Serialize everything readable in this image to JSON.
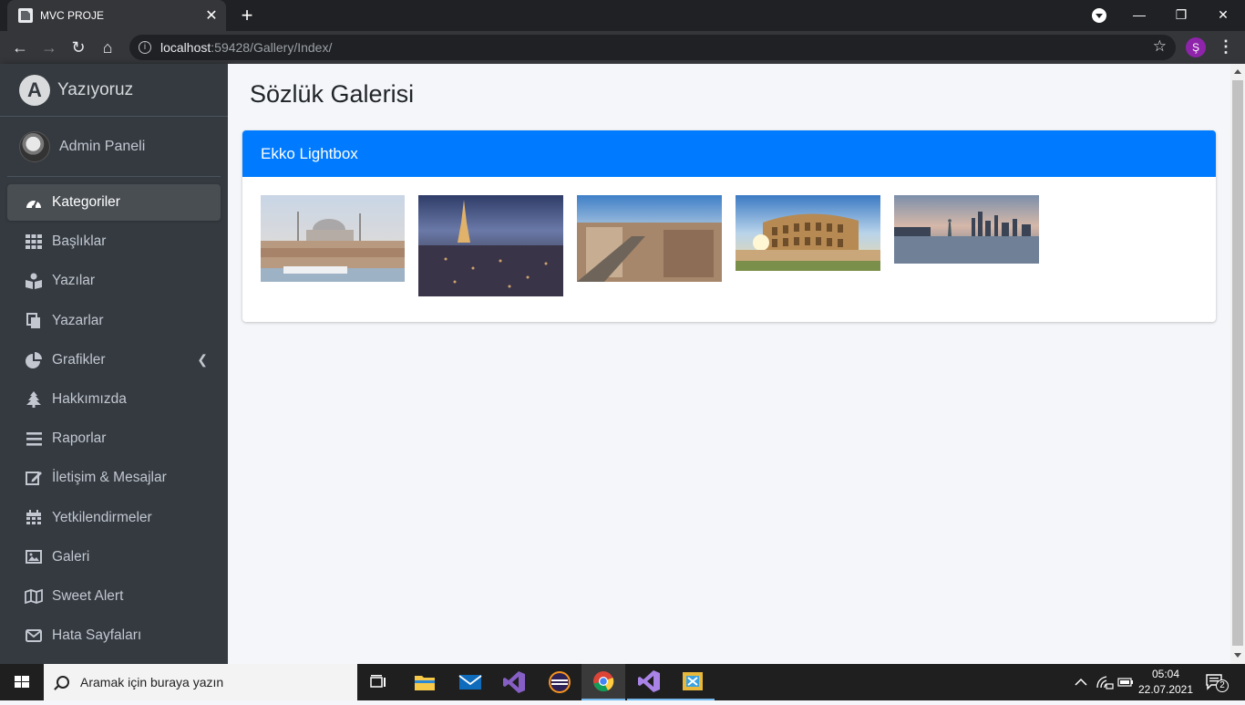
{
  "browser": {
    "tab_title": "MVC PROJE",
    "url_host": "localhost",
    "url_rest": ":59428/Gallery/Index/",
    "profile_initial": "Ş"
  },
  "sidebar": {
    "brand": "Yazıyoruz",
    "user": "Admin Paneli",
    "items": [
      {
        "label": "Kategoriler",
        "icon": "tachometer-icon",
        "active": true
      },
      {
        "label": "Başlıklar",
        "icon": "grid-icon"
      },
      {
        "label": "Yazılar",
        "icon": "book-reader-icon"
      },
      {
        "label": "Yazarlar",
        "icon": "copy-icon"
      },
      {
        "label": "Grafikler",
        "icon": "pie-chart-icon"
      },
      {
        "label": "Hakkımızda",
        "icon": "tree-icon"
      },
      {
        "label": "Raporlar",
        "icon": "bars-icon"
      },
      {
        "label": "İletişim & Mesajlar",
        "icon": "edit-icon"
      },
      {
        "label": "Yetkilendirmeler",
        "icon": "calendar-icon"
      },
      {
        "label": "Galeri",
        "icon": "image-icon"
      },
      {
        "label": "Sweet Alert",
        "icon": "map-icon"
      },
      {
        "label": "Hata Sayfaları",
        "icon": "envelope-icon"
      }
    ]
  },
  "main": {
    "title": "Sözlük Galerisi",
    "card_title": "Ekko Lightbox",
    "images": [
      {
        "name": "istanbul-thumbnail"
      },
      {
        "name": "paris-thumbnail"
      },
      {
        "name": "madrid-thumbnail"
      },
      {
        "name": "rome-colosseum-thumbnail"
      },
      {
        "name": "new-york-thumbnail"
      }
    ]
  },
  "taskbar": {
    "search_placeholder": "Aramak için buraya yazın",
    "time": "05:04",
    "date": "22.07.2021",
    "notification_count": "2"
  }
}
